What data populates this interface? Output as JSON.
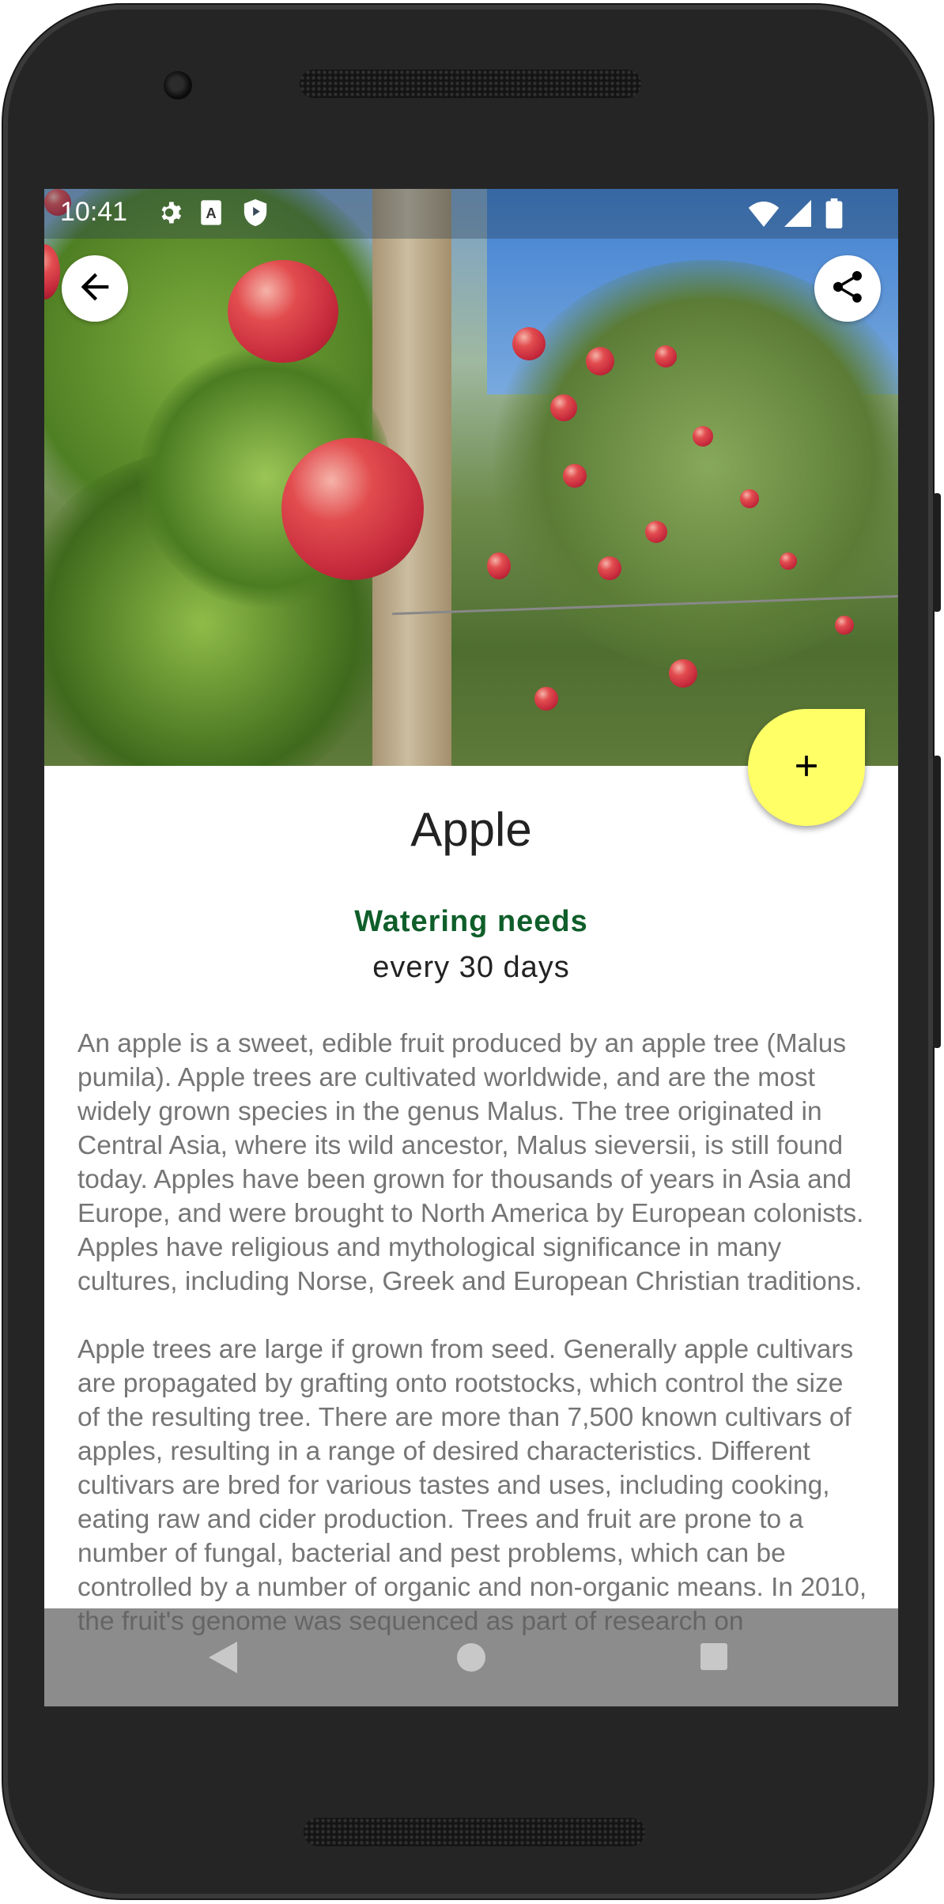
{
  "status_bar": {
    "time": "10:41",
    "left_icons": [
      "gear-icon",
      "font-a-icon",
      "shield-icon"
    ],
    "right_icons": [
      "wifi-icon",
      "cell-signal-icon",
      "battery-icon"
    ]
  },
  "hero": {
    "image": "apple-orchard-photo",
    "back_icon": "arrow-back-icon",
    "share_icon": "share-icon"
  },
  "fab": {
    "icon": "plus-icon",
    "label": "+"
  },
  "plant": {
    "name": "Apple",
    "watering_label": "Watering needs",
    "watering_value": "every 30 days",
    "description": [
      "An apple is a sweet, edible fruit produced by an apple tree (Malus pumila). Apple trees are cultivated worldwide, and are the most widely grown species in the genus Malus. The tree originated in Central Asia, where its wild ancestor, Malus sieversii, is still found today. Apples have been grown for thousands of years in Asia and Europe, and were brought to North America by European colonists. Apples have religious and mythological significance in many cultures, including Norse, Greek and European Christian traditions.",
      "Apple trees are large if grown from seed. Generally apple cultivars are propagated by grafting onto rootstocks, which control the size of the resulting tree. There are more than 7,500 known cultivars of apples, resulting in a range of desired characteristics. Different cultivars are bred for various tastes and uses, including cooking, eating raw and cider production. Trees and fruit are prone to a number of fungal, bacterial and pest problems, which can be controlled by a number of organic and non-organic means. In 2010, the fruit's genome was sequenced as part of research on"
    ]
  },
  "nav_bar": {
    "icons": [
      "nav-back-icon",
      "nav-home-icon",
      "nav-recents-icon"
    ]
  },
  "colors": {
    "fab": "#ffff66",
    "watering_label": "#0f5e2a",
    "description_text": "#757575",
    "title_text": "#222222"
  }
}
